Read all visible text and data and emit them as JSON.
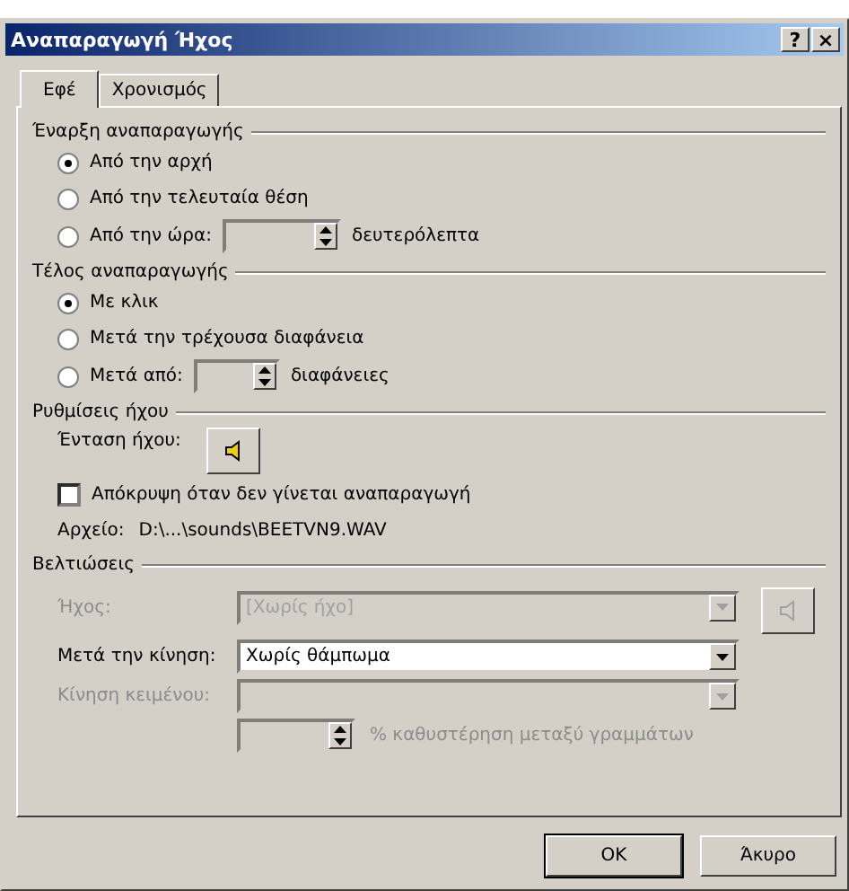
{
  "window": {
    "title": "Αναπαραγωγή Ήχος",
    "help": "?",
    "close": "×"
  },
  "tabs": [
    {
      "label": "Εφέ",
      "selected": true
    },
    {
      "label": "Χρονισμός",
      "selected": false
    }
  ],
  "groups": [
    {
      "title": "Έναρξη αναπαραγωγής",
      "items": [
        {
          "kind": "radio",
          "label": "Από την αρχή",
          "selected": true
        },
        {
          "kind": "radio",
          "label": "Από την τελευταία θέση",
          "selected": false
        },
        {
          "kind": "radio_spin",
          "label": "Από την ώρα:",
          "selected": false,
          "suffix": "δευτερόλεπτα"
        }
      ]
    },
    {
      "title": "Τέλος αναπαραγωγής",
      "items": [
        {
          "kind": "radio",
          "label": "Με κλικ",
          "selected": true
        },
        {
          "kind": "radio",
          "label": "Μετά την τρέχουσα διαφάνεια",
          "selected": false
        },
        {
          "kind": "radio_spin",
          "label": "Μετά από:",
          "selected": false,
          "suffix": "διαφάνειες"
        }
      ]
    },
    {
      "title": "Ρυθμίσεις ήχου",
      "items": [
        {
          "kind": "volume",
          "label": "Ένταση ήχου:"
        },
        {
          "kind": "checkbox",
          "label": "Απόκρυψη όταν δεν γίνεται αναπαραγωγή",
          "checked": false
        },
        {
          "kind": "file",
          "label": "Αρχείο:",
          "value": "D:\\...\\sounds\\BEETVN9.WAV"
        }
      ]
    },
    {
      "title": "Βελτιώσεις",
      "items": [
        {
          "kind": "combo_sound",
          "label": "Ήχος:",
          "value": "[Χωρίς ήχο]",
          "disabled": true
        },
        {
          "kind": "combo",
          "label": "Μετά την κίνηση:",
          "value": "Χωρίς θάμπωμα",
          "disabled": false
        },
        {
          "kind": "combo",
          "label": "Κίνηση κειμένου:",
          "disabled": true
        },
        {
          "kind": "spin_suffix",
          "suffix": "% καθυστέρηση μεταξύ γραμμάτων",
          "disabled": true
        }
      ]
    }
  ],
  "buttons": [
    "OK",
    "Άκυρο"
  ]
}
